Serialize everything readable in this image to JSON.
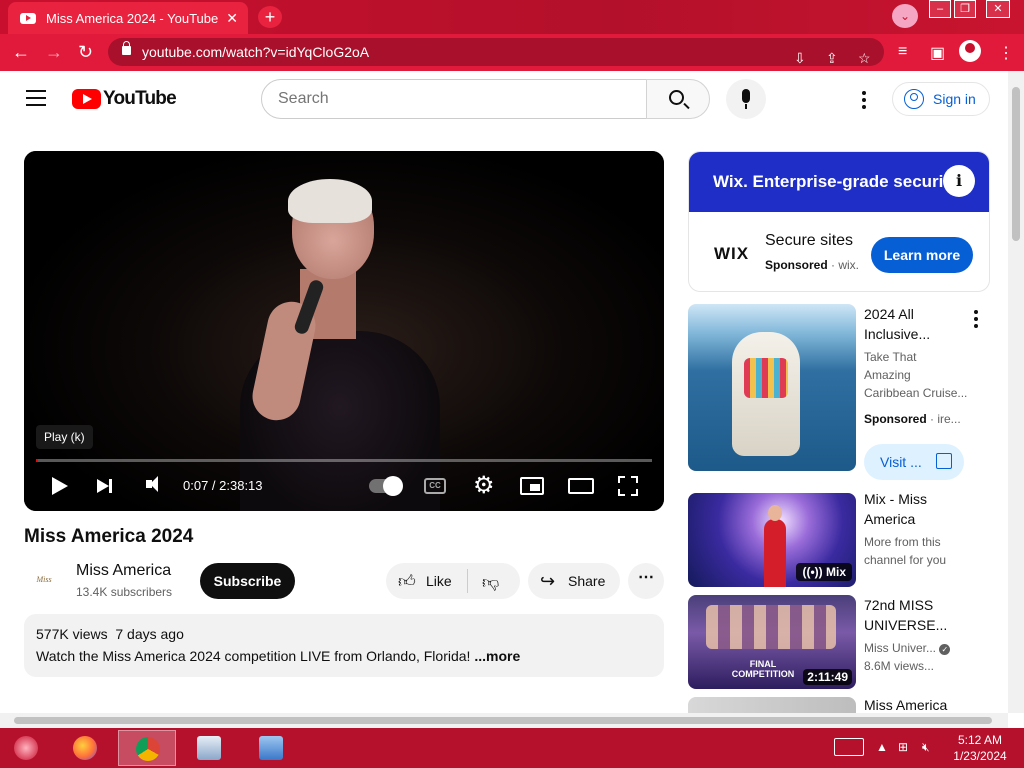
{
  "browser": {
    "tab_title": "Miss America 2024 - YouTube",
    "url": "youtube.com/watch?v=idYqCloG2oA"
  },
  "youtube": {
    "logo_text": "YouTube",
    "search_placeholder": "Search",
    "signin_label": "Sign in"
  },
  "player": {
    "tooltip": "Play (k)",
    "current_time": "0:07 / 2:38:13",
    "progress_fraction": 0.0007,
    "cc_label": "CC"
  },
  "video": {
    "title": "Miss America 2024",
    "channel_name": "Miss America",
    "channel_avatar_text": "Miss America",
    "subscribers": "13.4K subscribers",
    "subscribe_label": "Subscribe",
    "like_label": "Like",
    "share_label": "Share",
    "more_label": "⋯",
    "views": "577K views",
    "date": "7 days ago",
    "description": "Watch the Miss America 2024 competition LIVE from Orlando, Florida!",
    "description_more": "...more"
  },
  "sidebar": {
    "ad": {
      "banner": "Wix. Enterprise-grade security",
      "brand": "WIX",
      "title": "Secure sites",
      "sponsored": "Sponsored",
      "domain": "wix.",
      "cta": "Learn more"
    },
    "items": [
      {
        "title_line1": "2024 All",
        "title_line2": "Inclusive...",
        "meta_line1": "Take That",
        "meta_line2": "Amazing",
        "meta_line3": "Caribbean Cruise...",
        "sponsored": "Sponsored",
        "domain": "ire...",
        "cta": "Visit ..."
      },
      {
        "title_line1": "Mix - Miss",
        "title_line2": "America",
        "meta_line1": "More from this",
        "meta_line2": "channel for you",
        "badge": "Mix"
      },
      {
        "title_line1": "72nd MISS",
        "title_line2": "UNIVERSE...",
        "meta_line1": "Miss Univer...",
        "meta_line2": "8.6M views...",
        "duration": "2:11:49",
        "thumb_caption": "FINAL COMPETITION"
      },
      {
        "title_line1": "Miss America"
      }
    ]
  },
  "taskbar": {
    "time": "5:12 AM",
    "date": "1/23/2024"
  },
  "colors": {
    "browser_frame": "#c8102e",
    "youtube_red": "#ff0000",
    "link_blue": "#065fd4",
    "ad_blue": "#1e2ec6"
  }
}
